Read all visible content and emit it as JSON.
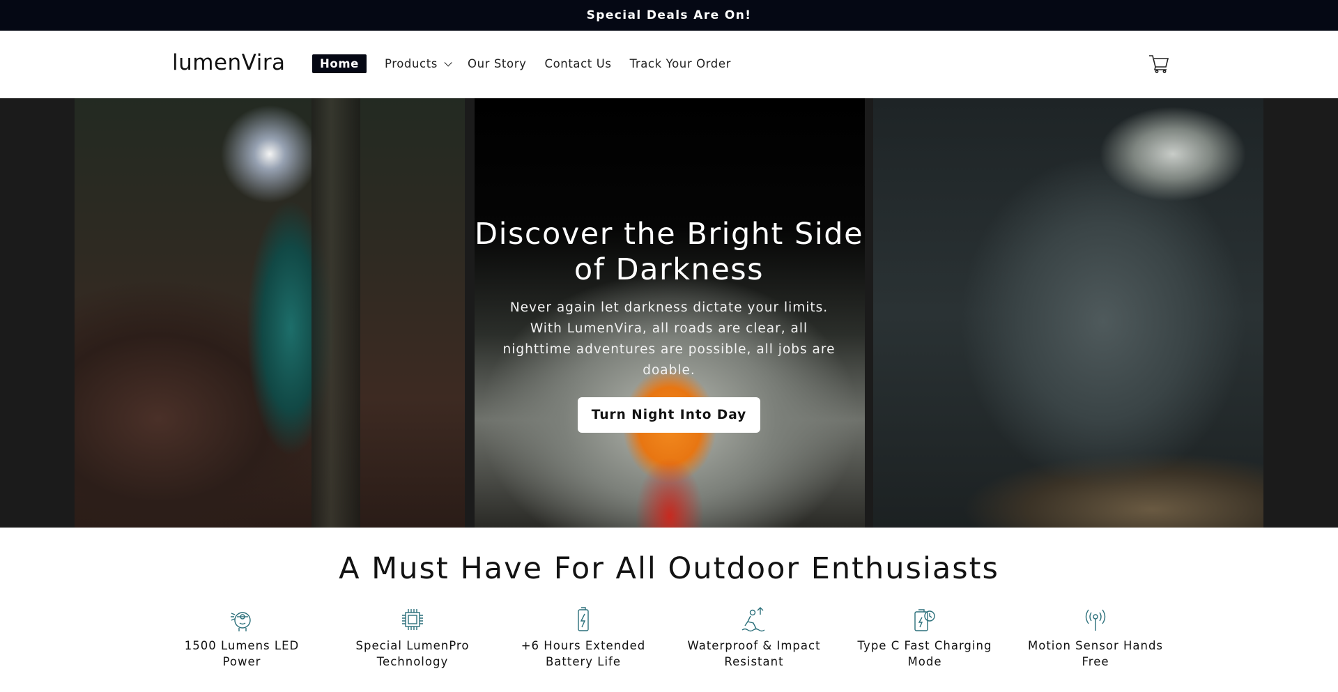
{
  "announcement": {
    "text": "Special Deals Are On!"
  },
  "header": {
    "logo": "lumenVira",
    "nav": [
      {
        "label": "Home",
        "active": true
      },
      {
        "label": "Products",
        "has_dropdown": true
      },
      {
        "label": "Our Story"
      },
      {
        "label": "Contact Us"
      },
      {
        "label": "Track Your Order"
      }
    ],
    "cart_icon": "cart-icon"
  },
  "hero": {
    "title": "Discover the Bright Side of Darkness",
    "subtitle": "Never again let darkness dictate your limits. With LumenVira, all roads are clear, all nighttime adventures are possible, all jobs are doable.",
    "button": "Turn Night Into Day"
  },
  "features": {
    "title": "A Must Have For All Outdoor Enthusiasts",
    "accent_color": "#2a6f7a",
    "items": [
      {
        "icon": "headlamp-icon",
        "label": "1500 Lumens LED Power"
      },
      {
        "icon": "chip-icon",
        "label": "Special LumenPro Technology"
      },
      {
        "icon": "battery-icon",
        "label": "+6 Hours Extended Battery Life"
      },
      {
        "icon": "waterproof-icon",
        "label": "Waterproof & Impact Resistant"
      },
      {
        "icon": "charging-icon",
        "label": "Type C Fast Charging Mode"
      },
      {
        "icon": "motion-sensor-icon",
        "label": "Motion Sensor Hands Free"
      }
    ]
  }
}
